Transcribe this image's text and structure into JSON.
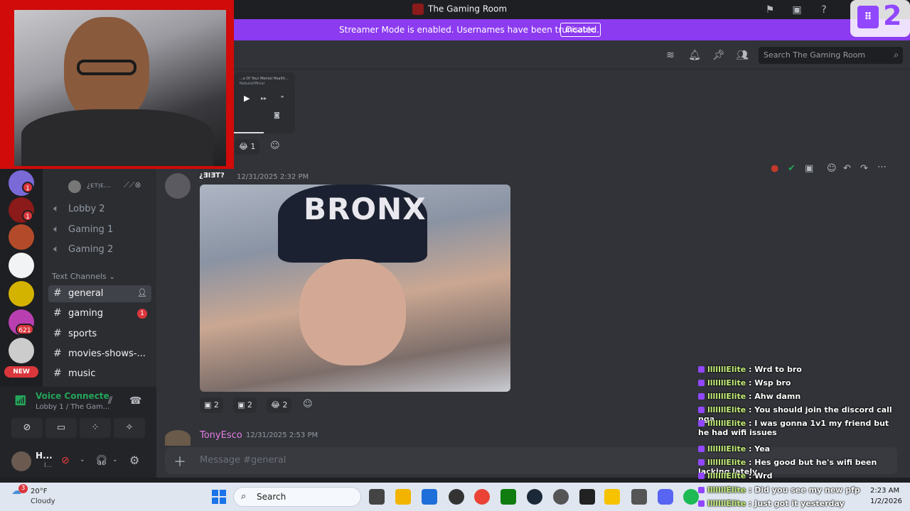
{
  "window": {
    "title": "The Gaming Room"
  },
  "streamer_banner": {
    "message": "Streamer Mode is enabled. Usernames have been truncated.",
    "disable_label": "Disable"
  },
  "header": {
    "search_placeholder": "Search The Gaming Room"
  },
  "servers": {
    "badges": [
      "1",
      "1",
      "621"
    ],
    "new_label": "NEW"
  },
  "channels": {
    "voice_user_label": "¿ᴇᴛᴉᴇ…",
    "voice": [
      "Lobby 2",
      "Gaming 1",
      "Gaming 2"
    ],
    "text_category": "Text Channels",
    "text": [
      {
        "name": "general",
        "badge": ""
      },
      {
        "name": "gaming",
        "badge": "1"
      },
      {
        "name": "sports",
        "badge": ""
      },
      {
        "name": "movies-shows-...",
        "badge": ""
      },
      {
        "name": "music",
        "badge": ""
      }
    ]
  },
  "voice_panel": {
    "status": "Voice Connecte",
    "location": "Lobby 1 / The Gam..."
  },
  "user_panel": {
    "name": "H...",
    "sub": "I..."
  },
  "chat": {
    "prev_video_title": "...e Of Your Mental Health...",
    "prev_video_sub": "NebulaOfficial",
    "prev_reaction_count": "1",
    "message1": {
      "author": "¿ƎIƎT?",
      "timestamp": "12/31/2025 2:32 PM",
      "image_caption": "BRONX",
      "reactions": [
        "2",
        "2",
        "2"
      ]
    },
    "message2": {
      "author": "TonyEsco",
      "timestamp": "12/31/2025 2:53 PM"
    },
    "input_placeholder": "Message #general"
  },
  "stream_chat": [
    {
      "user": "lllllllElite",
      "text": "Wrd to bro"
    },
    {
      "user": "lllllllElite",
      "text": "Wsp bro"
    },
    {
      "user": "lllllllElite",
      "text": "Ahw damn"
    },
    {
      "user": "lllllllElite",
      "text": "You should join the discord call nga"
    },
    {
      "user": "lllllllElite",
      "text": "I was gonna 1v1 my friend but he had wifi issues"
    },
    {
      "user": "lllllllElite",
      "text": "Yea"
    },
    {
      "user": "lllllllElite",
      "text": "Hes good but he's wifi been lacking lately"
    },
    {
      "user": "lllllllElite",
      "text": "Wrd"
    },
    {
      "user": "lllllllElite",
      "text": "Did you see my new pfp"
    },
    {
      "user": "lllllllElite",
      "text": "Just got it yesterday"
    }
  ],
  "twitch_overlay": {
    "count": "2"
  },
  "taskbar": {
    "weather_temp": "20°F",
    "weather_desc": "Cloudy",
    "weather_badge": "3",
    "search_label": "Search",
    "time": "2:23 AM",
    "date": "1/2/2026"
  },
  "colors": {
    "accent": "#8c3bf0",
    "discord_bg": "#313338",
    "webcam_frame": "#d10a0a"
  }
}
